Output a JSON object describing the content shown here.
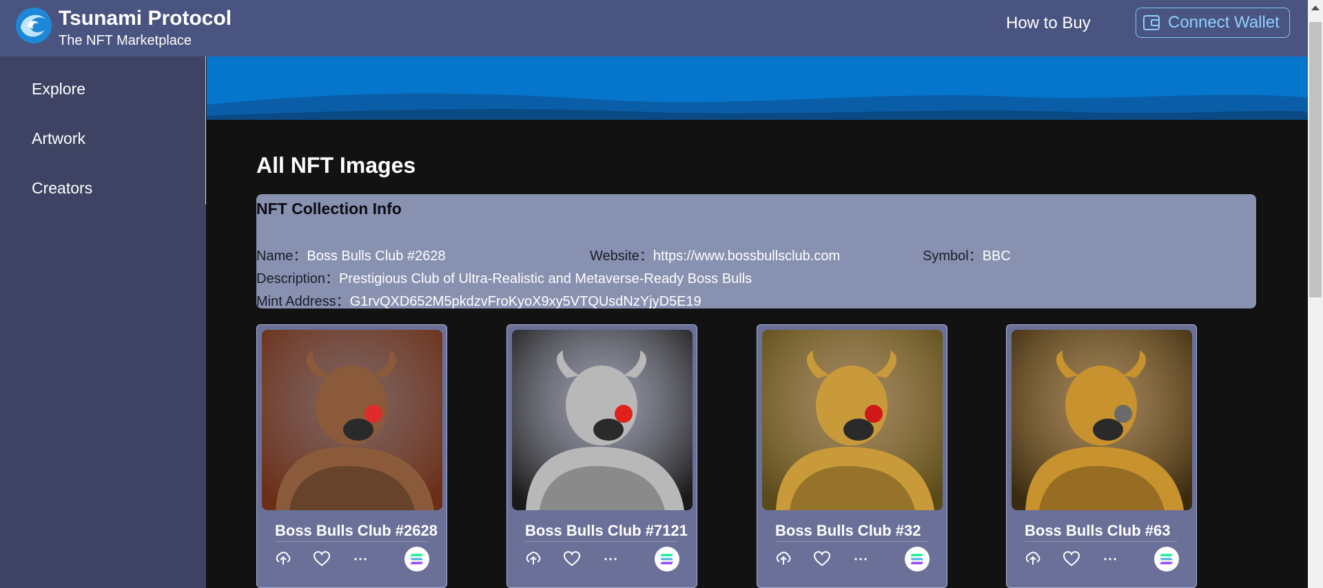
{
  "header": {
    "brand_title": "Tsunami Protocol",
    "brand_subtitle": "The NFT Marketplace",
    "how_to_buy": "How to Buy",
    "connect_wallet": "Connect Wallet"
  },
  "sidebar": {
    "items": [
      {
        "label": "Explore"
      },
      {
        "label": "Artwork"
      },
      {
        "label": "Creators"
      }
    ]
  },
  "main": {
    "title": "All NFT Images",
    "collection": {
      "heading": "NFT Collection Info",
      "name_label": "Name：",
      "name": "Boss Bulls Club #2628",
      "website_label": "Website：",
      "website": "https://www.bossbullsclub.com",
      "symbol_label": "Symbol：",
      "symbol": "BBC",
      "description_label": "Description：",
      "description": "Prestigious Club of Ultra-Realistic and Metaverse-Ready Boss Bulls",
      "mint_label": "Mint Address：",
      "mint_address": "G1rvQXD652M5pkdzvFroKyoX9xy5VTQUsdNzYjyD5E19"
    },
    "cards": [
      {
        "name": "Boss Bulls Club #2628",
        "bg": "#6b2e17",
        "metal": "#8a5a3a",
        "accent": "#e02b2b"
      },
      {
        "name": "Boss Bulls Club #7121",
        "bg": "#1a1a1a",
        "metal": "#b8b8b8",
        "accent": "#e0201a"
      },
      {
        "name": "Boss Bulls Club #32",
        "bg": "#5a4a1a",
        "metal": "#c99a3a",
        "accent": "#d01818"
      },
      {
        "name": "Boss Bulls Club #63",
        "bg": "#3a2a10",
        "metal": "#c8922e",
        "accent": "#6a6a6a"
      }
    ]
  },
  "colors": {
    "header_bg": "#4a5480",
    "sidebar_bg": "#3e4363",
    "main_bg": "#121212",
    "info_bg": "#8991b0",
    "card_bg": "#6a7098",
    "accent_link": "#8fd1ff",
    "banner_blue": "#0576cc"
  },
  "icons": {
    "logo": "wave-logo-icon",
    "wallet": "wallet-icon",
    "share": "upload-icon",
    "like": "heart-icon",
    "more": "ellipsis-icon",
    "chain": "solana-icon"
  }
}
